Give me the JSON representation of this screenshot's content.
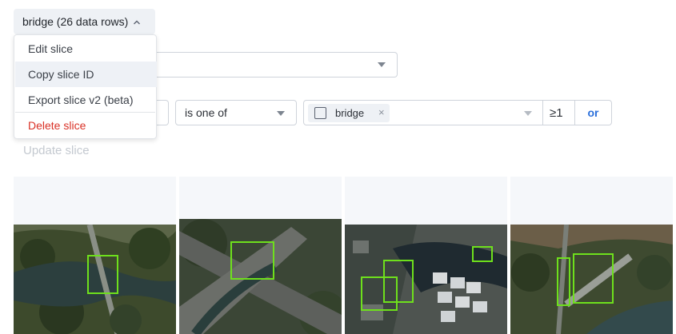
{
  "slice": {
    "trigger_label": "bridge (26 data rows)",
    "menu": {
      "items": [
        "Edit slice",
        "Copy slice ID",
        "Export slice v2 (beta)"
      ],
      "danger_item": "Delete slice"
    }
  },
  "filter": {
    "operator": "is one of",
    "chip_label": "bridge",
    "chip_remove": "×",
    "count": "≥1",
    "or_label": "or"
  },
  "update_label": "Update slice",
  "colors": {
    "accent": "#2a6fdb",
    "danger": "#d93025",
    "bbox": "#6ee01c"
  },
  "tiles": [
    {
      "icon": "aerial-bridge-image",
      "boxes": 1
    },
    {
      "icon": "aerial-bridge-image",
      "boxes": 1
    },
    {
      "icon": "aerial-bridge-image",
      "boxes": 3
    },
    {
      "icon": "aerial-bridge-image",
      "boxes": 2
    }
  ]
}
